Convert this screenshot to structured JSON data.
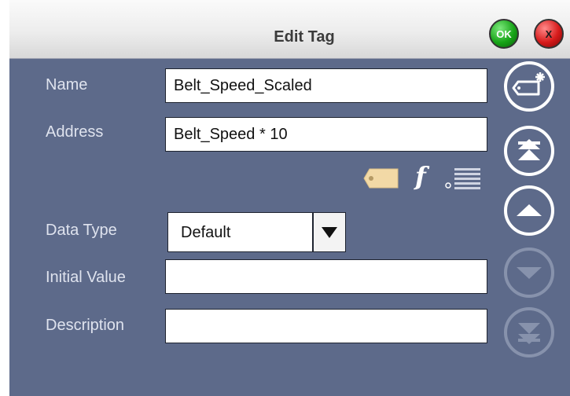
{
  "window": {
    "title": "Edit Tag",
    "ok_label": "OK",
    "cancel_label": "X"
  },
  "fields": {
    "name": {
      "label": "Name",
      "value": "Belt_Speed_Scaled"
    },
    "address": {
      "label": "Address",
      "value": "Belt_Speed * 10"
    },
    "data_type": {
      "label": "Data Type",
      "value": "Default"
    },
    "initial_value": {
      "label": "Initial Value",
      "value": ""
    },
    "description": {
      "label": "Description",
      "value": ""
    }
  },
  "address_tools": {
    "tag_icon": "tag-icon",
    "function_label": "f",
    "list_icon": "list-icon"
  },
  "side_buttons": [
    "new-tag-icon",
    "move-to-top-icon",
    "move-up-icon",
    "move-down-icon",
    "move-to-bottom-icon"
  ],
  "colors": {
    "panel": "#5d6a8a",
    "label": "#dfe3ee",
    "ok": "#18a518",
    "cancel": "#d61a1a",
    "accent": "#f2d9a6"
  }
}
